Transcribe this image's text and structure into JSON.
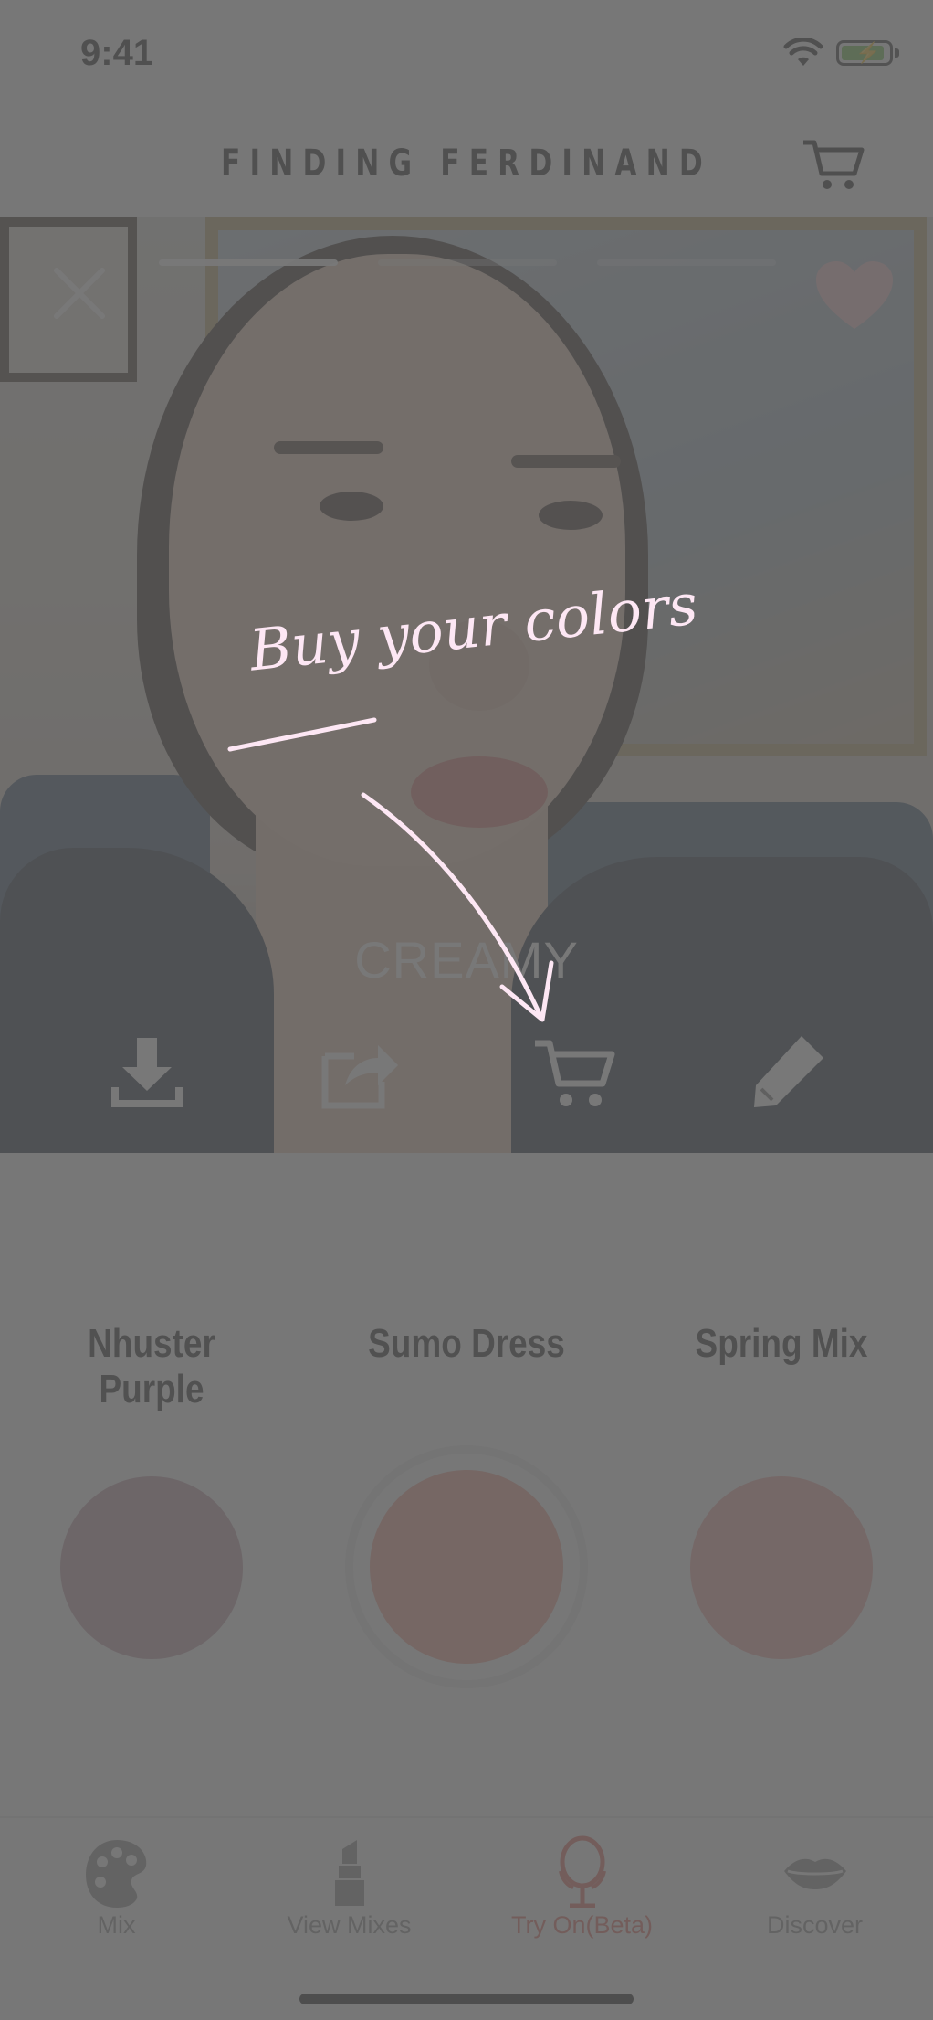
{
  "status_bar": {
    "time": "9:41"
  },
  "header": {
    "brand": "FINDING FERDINAND"
  },
  "photo": {
    "style_label": "CREAMY",
    "story_progress": {
      "segments": 3,
      "active_index": 0
    }
  },
  "actions": [
    "download",
    "share",
    "cart",
    "edit"
  ],
  "colors": [
    {
      "name": "Nhuster Purple",
      "hex": "#c09aa8"
    },
    {
      "name": "Sumo Dress",
      "hex": "#f0a08f"
    },
    {
      "name": "Spring Mix",
      "hex": "#eea5a2"
    }
  ],
  "selected_color_index": 1,
  "tabs": [
    {
      "label": "Mix",
      "icon": "palette-icon"
    },
    {
      "label": "View Mixes",
      "icon": "lipstick-icon"
    },
    {
      "label": "Try On(Beta)",
      "icon": "mirror-icon"
    },
    {
      "label": "Discover",
      "icon": "lips-icon"
    }
  ],
  "active_tab_index": 2,
  "overlay": {
    "hint": "Buy your colors"
  },
  "theme": {
    "accent": "#e0685f",
    "hint_color": "#fde7f4"
  }
}
